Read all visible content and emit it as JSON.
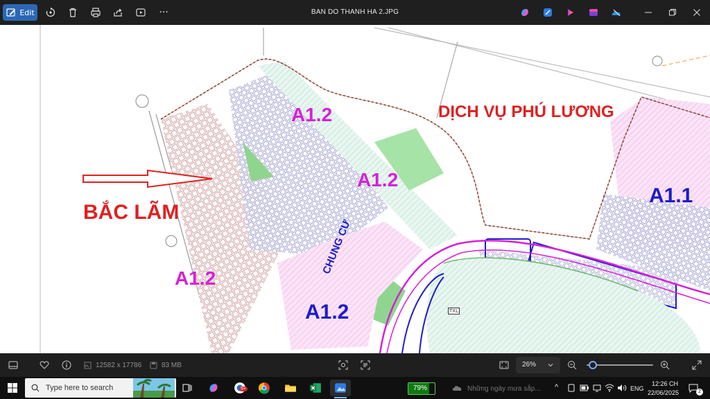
{
  "titlebar": {
    "edit_label": "Edit",
    "file_title": "BAN DO THANH HA 2.JPG",
    "tools": [
      "rotate-icon",
      "delete-icon",
      "print-icon",
      "share-icon",
      "slideshow-icon",
      "more-icon"
    ],
    "apps": [
      "copilot-icon",
      "designer-icon",
      "clipchamp-icon",
      "photos-icon",
      "onedrive-icon"
    ]
  },
  "map": {
    "label_bac_lam": "BẮC LÃM",
    "label_dich_vu": "DỊCH VỤ PHÚ LƯƠNG",
    "label_a12_top": "A1.2",
    "label_a12_mid": "A1.2",
    "label_a12_left": "A1.2",
    "label_a12_bottom": "A1.2",
    "label_a11": "A1.1",
    "label_chung_cu": "CHUNG CƯ",
    "label_txl": "TXL",
    "colors": {
      "red": "#e02020",
      "magenta": "#d81fd8",
      "blue": "#1c1cc8",
      "green": "#8fd58f",
      "pink": "#f3c6ec"
    }
  },
  "bottombar": {
    "dimensions": "12582 x 17786",
    "filesize": "83 MB",
    "zoom": "26%",
    "zoom_level": 0.03
  },
  "taskbar": {
    "search_placeholder": "Type here to search",
    "battery": "79%",
    "weather": "Những ngày mưa sắp...",
    "lang": "ENG",
    "time": "12:26 CH",
    "date": "22/06/2025",
    "notifications": "2",
    "chrome_badge": "5+"
  }
}
